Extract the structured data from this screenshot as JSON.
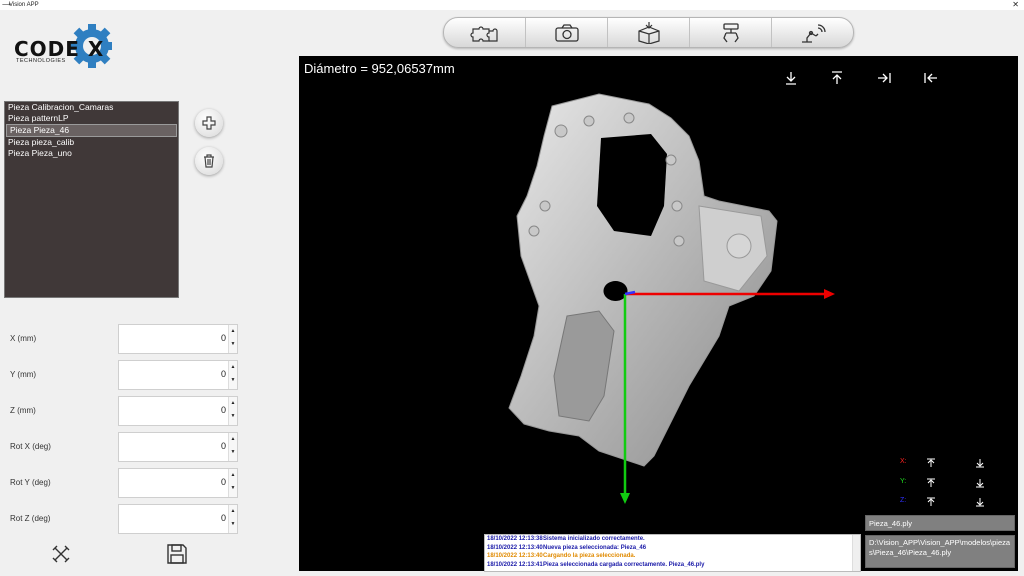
{
  "window": {
    "title": "Vision APP",
    "close_glyph": "✕"
  },
  "logo": {
    "brand": "CODE X",
    "subtitle": "TECHNOLOGIES"
  },
  "toolbar": [
    "puzzle-icon",
    "camera-icon",
    "box-import-icon",
    "robot-gripper-icon",
    "robot-arm-signal-icon"
  ],
  "pieces": [
    {
      "label": "Pieza Calibracion_Camaras",
      "selected": false
    },
    {
      "label": "Pieza patternLP",
      "selected": false
    },
    {
      "label": "Pieza Pieza_46",
      "selected": true
    },
    {
      "label": "Pieza pieza_calib",
      "selected": false
    },
    {
      "label": "Pieza Pieza_uno",
      "selected": false
    }
  ],
  "fields": [
    {
      "label": "X (mm)",
      "value": "0"
    },
    {
      "label": "Y (mm)",
      "value": "0"
    },
    {
      "label": "Z (mm)",
      "value": "0"
    },
    {
      "label": "Rot X (deg)",
      "value": "0"
    },
    {
      "label": "Rot Y (deg)",
      "value": "0"
    },
    {
      "label": "Rot Z (deg)",
      "value": "0"
    }
  ],
  "viewer": {
    "diameter": "Diámetro = 952,06537mm",
    "axes": [
      {
        "label": "X:",
        "color": "#ff2020"
      },
      {
        "label": "Y:",
        "color": "#20e020"
      },
      {
        "label": "Z:",
        "color": "#3030ff"
      }
    ]
  },
  "file": {
    "name": "Pieza_46.ply",
    "path": "D:\\Vision_APP\\Vision_APP\\modelos\\piezas\\Pieza_46\\Pieza_46.ply"
  },
  "log": [
    {
      "ts": "18/10/2022 12:13:38",
      "msg": "Sistema inicializado correctamente.",
      "color": "#1a1aa8"
    },
    {
      "ts": "18/10/2022 12:13:40",
      "msg": "Nueva pieza seleccionada: Pieza_46",
      "color": "#1a1aa8"
    },
    {
      "ts": "18/10/2022 12:13:40",
      "msg": "Cargando la pieza seleccionada.",
      "color": "#e08a00"
    },
    {
      "ts": "18/10/2022 12:13:41",
      "msg": "Pieza seleccionada cargada correctamente. Pieza_46.ply",
      "color": "#1a1aa8"
    }
  ]
}
